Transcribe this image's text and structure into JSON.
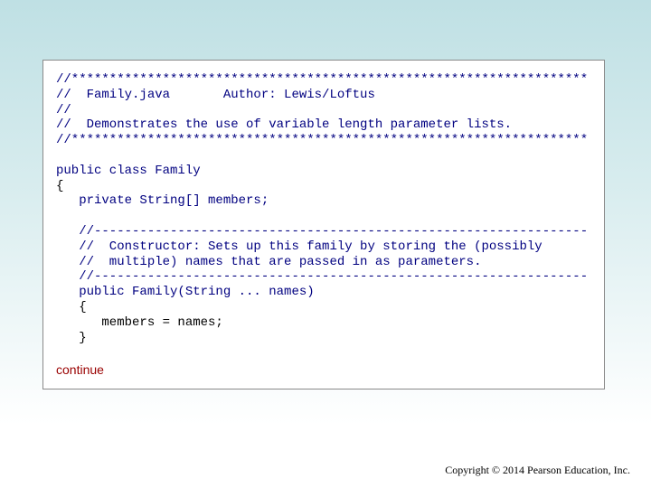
{
  "code": {
    "lines": [
      "//********************************************************************",
      "//  Family.java       Author: Lewis/Loftus",
      "//",
      "//  Demonstrates the use of variable length parameter lists.",
      "//********************************************************************",
      "",
      "public class Family",
      "{",
      "   private String[] members;",
      "",
      "   //-----------------------------------------------------------------",
      "   //  Constructor: Sets up this family by storing the (possibly",
      "   //  multiple) names that are passed in as parameters.",
      "   //-----------------------------------------------------------------",
      "   public Family(String ... names)",
      "   {",
      "      members = names;",
      "   }"
    ]
  },
  "continue_label": "continue",
  "copyright": "Copyright © 2014 Pearson Education, Inc."
}
